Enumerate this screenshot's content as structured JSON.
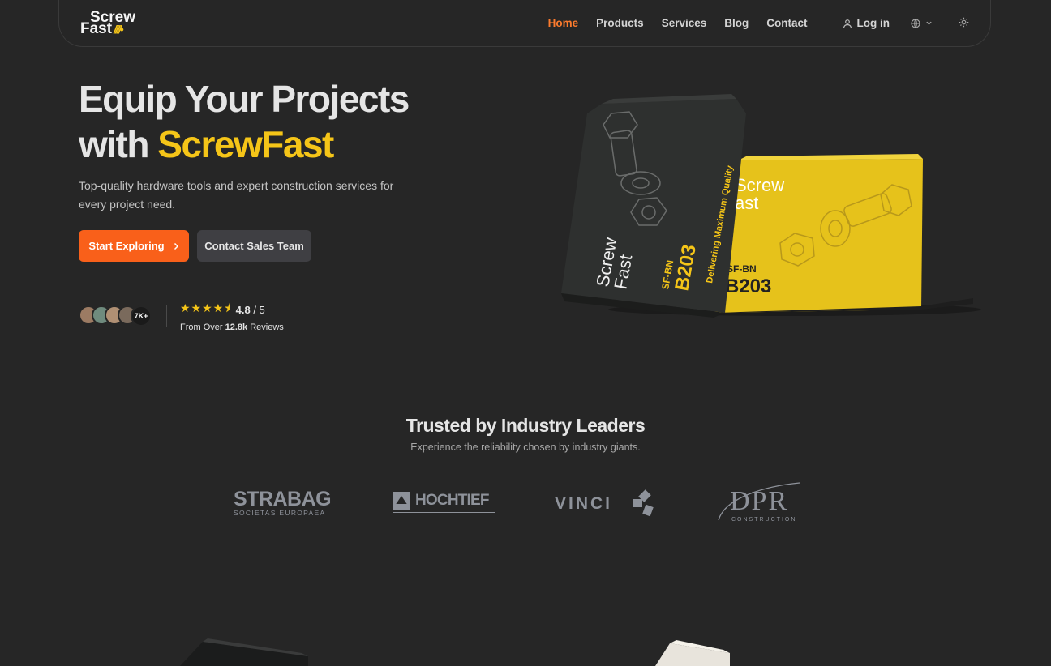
{
  "brand": {
    "line1": "Screw",
    "line2": "Fast",
    "accent": "#f5c518"
  },
  "nav": {
    "links": [
      {
        "label": "Home",
        "active": true
      },
      {
        "label": "Products"
      },
      {
        "label": "Services"
      },
      {
        "label": "Blog"
      },
      {
        "label": "Contact"
      }
    ],
    "login": "Log in",
    "icons": {
      "user": "user-icon",
      "language": "globe-icon",
      "chevron": "chevron-down-icon",
      "theme": "sun-icon"
    }
  },
  "hero": {
    "title_line1": "Equip Your Projects",
    "title_with": "with",
    "title_accent": "ScrewFast",
    "subtitle": "Top-quality hardware tools and expert construction services for every project need.",
    "primary_button": "Start Exploring",
    "secondary_button": "Contact Sales Team",
    "reviews": {
      "avatar_count_label": "7K+",
      "rating": "4.8",
      "rating_max": "/ 5",
      "stars": 4.5,
      "from_prefix": "From Over",
      "review_count": "12.8k",
      "from_suffix": "Reviews"
    }
  },
  "product_art": {
    "dark_box": {
      "brand_1": "Screw",
      "brand_2": "Fast",
      "code": "SF-BN",
      "model": "B203",
      "tagline": "Delivering Maximum Quality"
    },
    "yellow_box": {
      "brand_1": "Screw",
      "brand_2": "ast",
      "code": "SF-BN",
      "model": "B203"
    }
  },
  "trusted": {
    "title": "Trusted by Industry Leaders",
    "subtitle": "Experience the reliability chosen by industry giants.",
    "partners": [
      {
        "name": "STRABAG",
        "sub": "SOCIETAS EUROPAEA"
      },
      {
        "name": "HOCHTIEF"
      },
      {
        "name": "VINCI"
      },
      {
        "name": "DPR",
        "sub": "CONSTRUCTION"
      }
    ]
  },
  "colors": {
    "background": "#262626",
    "primary": "#f9601a",
    "accent": "#f5c518",
    "nav_active": "#fb7a2d"
  }
}
